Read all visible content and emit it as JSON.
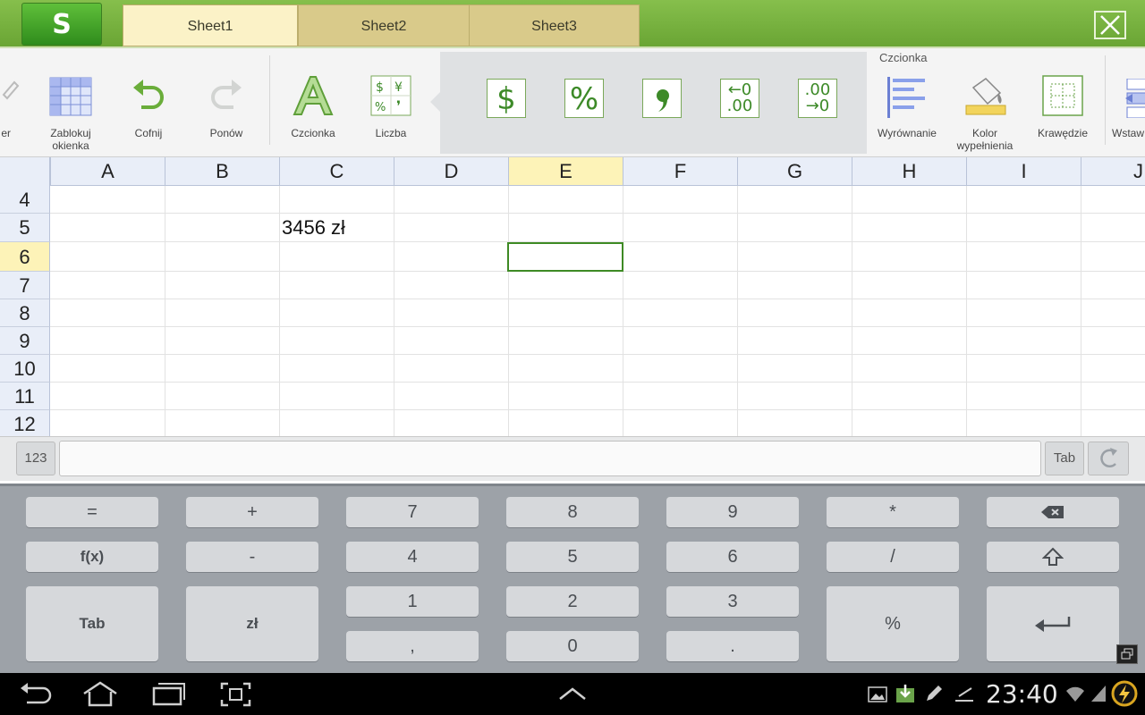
{
  "app": {
    "logo_letter": "S"
  },
  "tabs": [
    {
      "label": "Sheet1",
      "active": true
    },
    {
      "label": "Sheet2",
      "active": false
    },
    {
      "label": "Sheet3",
      "active": false
    }
  ],
  "ribbon": {
    "partial_left_label": "er",
    "freeze_label_line1": "Zablokuj",
    "freeze_label_line2": "okienka",
    "undo_label": "Cofnij",
    "redo_label": "Ponów",
    "font_label": "Czcionka",
    "number_label": "Liczba",
    "number_formats": [
      {
        "name": "currency-format",
        "glyph": "$"
      },
      {
        "name": "percent-format",
        "glyph": "%"
      },
      {
        "name": "comma-format",
        "glyph": "❜"
      },
      {
        "name": "increase-decimal",
        "glyph_top": "←0",
        "glyph_bottom": ".00"
      },
      {
        "name": "decrease-decimal",
        "glyph_top": ".00",
        "glyph_bottom": "→0"
      }
    ],
    "group_title": "Czcionka",
    "align_label": "Wyrównanie",
    "fill_label_line1": "Kolor",
    "fill_label_line2": "wypełnienia",
    "borders_label": "Krawędzie",
    "insert_label": "Wstaw"
  },
  "grid": {
    "columns": [
      "A",
      "B",
      "C",
      "D",
      "E",
      "F",
      "G",
      "H",
      "I",
      "J"
    ],
    "selected_column": "E",
    "rows": [
      "4",
      "5",
      "6",
      "7",
      "8",
      "9",
      "10",
      "11",
      "12"
    ],
    "selected_row": "6",
    "cells": {
      "C5": "3456 zł"
    }
  },
  "formula_bar": {
    "mode_label": "123",
    "value": "",
    "tab_label": "Tab"
  },
  "keyboard": {
    "keys": {
      "eq": "=",
      "plus": "+",
      "k7": "7",
      "k8": "8",
      "k9": "9",
      "mul": "*",
      "fx": "f(x)",
      "minus": "-",
      "k4": "4",
      "k5": "5",
      "k6": "6",
      "div": "/",
      "tab": "Tab",
      "currency": "zł",
      "k1": "1",
      "k2": "2",
      "k3": "3",
      "pct": "%",
      "comma": ",",
      "k0": "0",
      "dot": "."
    }
  },
  "status": {
    "time": "23:40"
  },
  "colors": {
    "brand_green": "#7cb342",
    "selection": "#3e8a24",
    "header_highlight": "#fdf3b8"
  }
}
